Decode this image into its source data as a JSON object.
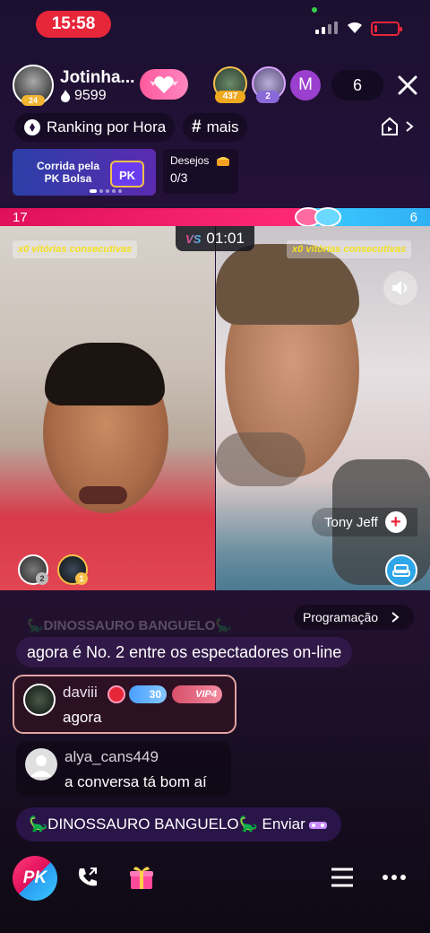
{
  "status_bar": {
    "time": "15:58",
    "battery_level": 0.1,
    "colors": {
      "time_pill": "#e8263a",
      "battery": "#e8263a",
      "mic_dot": "#35d04a"
    }
  },
  "host": {
    "name": "Jotinha...",
    "fans": "9599",
    "level": "24"
  },
  "viewers": {
    "top": [
      {
        "badge": "437"
      },
      {
        "badge": "2"
      },
      {
        "initial": "M"
      }
    ],
    "count": "6"
  },
  "tags": {
    "ranking": "Ranking por Hora",
    "hashtag": "mais"
  },
  "pk_banner": {
    "line1": "Corrida pela",
    "line2": "PK Bolsa"
  },
  "wishes": {
    "label": "Desejos",
    "progress": "0/3"
  },
  "pk": {
    "score_left": "17",
    "score_right": "6",
    "vs": "VS",
    "timer": "01:01",
    "streak_left": "x0 vitórias consecutivas",
    "streak_right": "x0 vitórias consecutivas",
    "opponent_name": "Tony Jeff",
    "supporters": [
      "2",
      "1"
    ],
    "colors": {
      "left": "#e0105a",
      "right": "#3ac8ff"
    }
  },
  "chat": {
    "schedule_button": "Programação",
    "faded_line": "🦕DINOSSAURO BANGUELO🦕",
    "system_message": "agora é No. 2 entre os espectadores on-line",
    "messages": [
      {
        "user": "daviii",
        "level": "30",
        "vip": "VIP4",
        "text": "agora"
      },
      {
        "user": "alya_cans449",
        "text": "a conversa tá bom aí"
      }
    ],
    "gift_line": "🦕DINOSSAURO BANGUELO🦕 Enviar"
  },
  "bottom_bar": {
    "pk_label": "PK",
    "icons": [
      "call-icon",
      "gift-icon",
      "menu-icon",
      "more-icon"
    ]
  }
}
